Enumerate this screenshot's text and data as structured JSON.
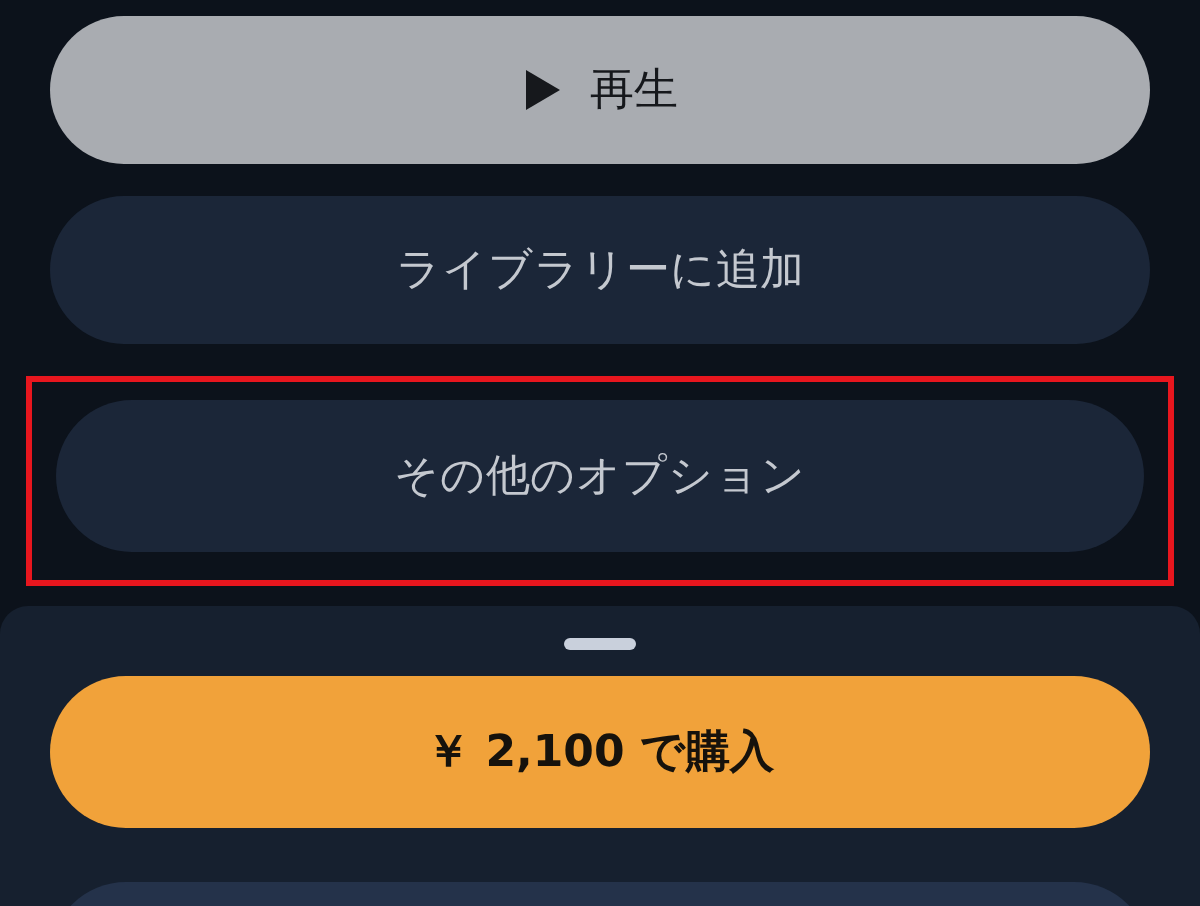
{
  "actions": [
    {
      "kind": "play",
      "label": "再生",
      "highlighted": false
    },
    {
      "kind": "secondary",
      "label": "ライブラリーに追加",
      "highlighted": false
    },
    {
      "kind": "secondary",
      "label": "その他のオプション",
      "highlighted": true
    }
  ],
  "sheet": {
    "buttons": [
      {
        "kind": "buy",
        "label": "￥ 2,100 で購入"
      },
      {
        "kind": "sheet-secondary"
      }
    ]
  }
}
